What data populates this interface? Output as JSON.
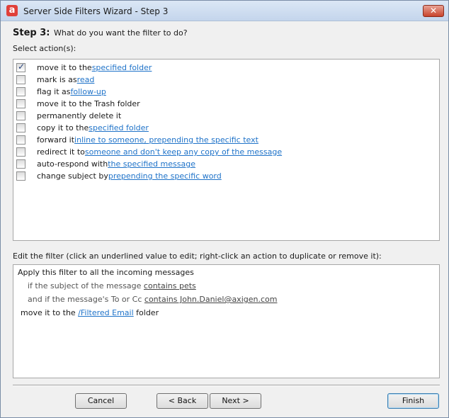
{
  "window": {
    "title": "Server Side Filters Wizard - Step 3",
    "app_icon_letter": "a",
    "close_glyph": "✕"
  },
  "step": {
    "number_label": "Step 3:",
    "question": "What do you want the filter to do?"
  },
  "select_actions_label": "Select action(s):",
  "actions": [
    {
      "checked": true,
      "prefix": "move it to the ",
      "link": "specified folder"
    },
    {
      "checked": false,
      "prefix": "mark is as ",
      "link": "read"
    },
    {
      "checked": false,
      "prefix": "flag it as ",
      "link": "follow-up"
    },
    {
      "checked": false,
      "prefix": "move it to the Trash folder",
      "link": ""
    },
    {
      "checked": false,
      "prefix": "permanently delete it",
      "link": ""
    },
    {
      "checked": false,
      "prefix": "copy it to the ",
      "link": "specified folder"
    },
    {
      "checked": false,
      "prefix": "forward it ",
      "link": "inline to someone, prepending the specific text"
    },
    {
      "checked": false,
      "prefix": "redirect it to ",
      "link": "someone and don't keep any copy of the message"
    },
    {
      "checked": false,
      "prefix": "auto-respond with ",
      "link": "the specified message"
    },
    {
      "checked": false,
      "prefix": "change subject by ",
      "link": "prepending the specific word"
    }
  ],
  "edit_filter_label": "Edit the filter (click an underlined value to edit; right-click an action to duplicate or remove it):",
  "filter": {
    "line1": "Apply this filter to all the incoming messages",
    "line2_prefix": "if the subject of the message ",
    "line2_value": "contains pets",
    "line3_prefix": "and if the message's To or Cc ",
    "line3_value": "contains John.Daniel@axigen.com",
    "line4_prefix": "move it to the ",
    "line4_value": "/Filtered Email",
    "line4_suffix": " folder"
  },
  "buttons": {
    "cancel": "Cancel",
    "back": "< Back",
    "next": "Next >",
    "finish": "Finish"
  },
  "colors": {
    "link": "#1f73c9",
    "close_button": "#c8432c",
    "app_icon": "#e0403a"
  }
}
